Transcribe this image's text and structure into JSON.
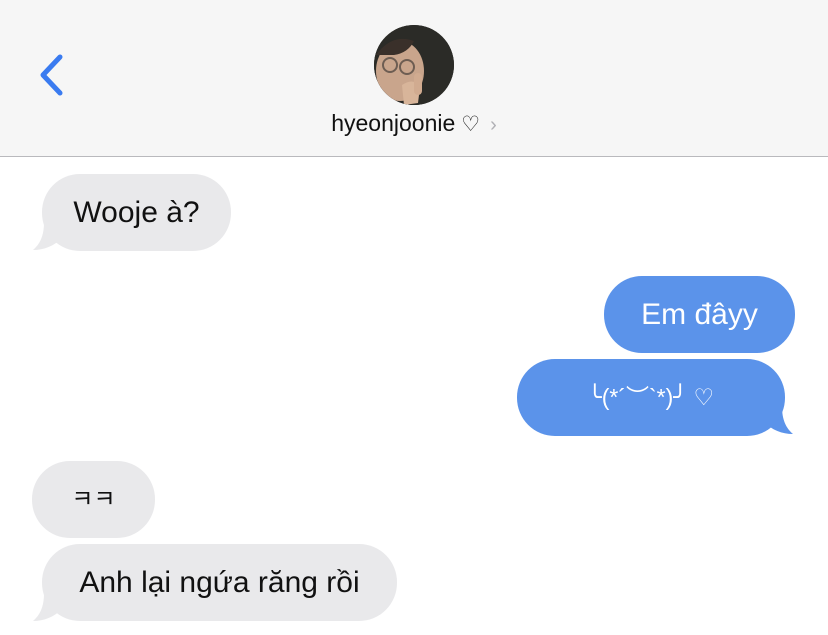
{
  "header": {
    "contact_name": "hyeonjoonie",
    "contact_heart": "♡",
    "chevron": "›",
    "back_icon": "chevron-left-icon",
    "accent_color": "#3a7bf0"
  },
  "messages": [
    {
      "direction": "incoming",
      "text": "Wooje à?"
    },
    {
      "direction": "outgoing",
      "text": "Em đâyy"
    },
    {
      "direction": "outgoing",
      "text": "╰(*´︶`*)╯ ♡"
    },
    {
      "direction": "incoming",
      "text": "ㅋㅋ"
    },
    {
      "direction": "incoming",
      "text": "Anh lại ngứa răng rồi"
    }
  ],
  "colors": {
    "incoming_bubble": "#e9e9eb",
    "outgoing_bubble": "#5b93ea",
    "header_bg": "#f6f6f6"
  }
}
